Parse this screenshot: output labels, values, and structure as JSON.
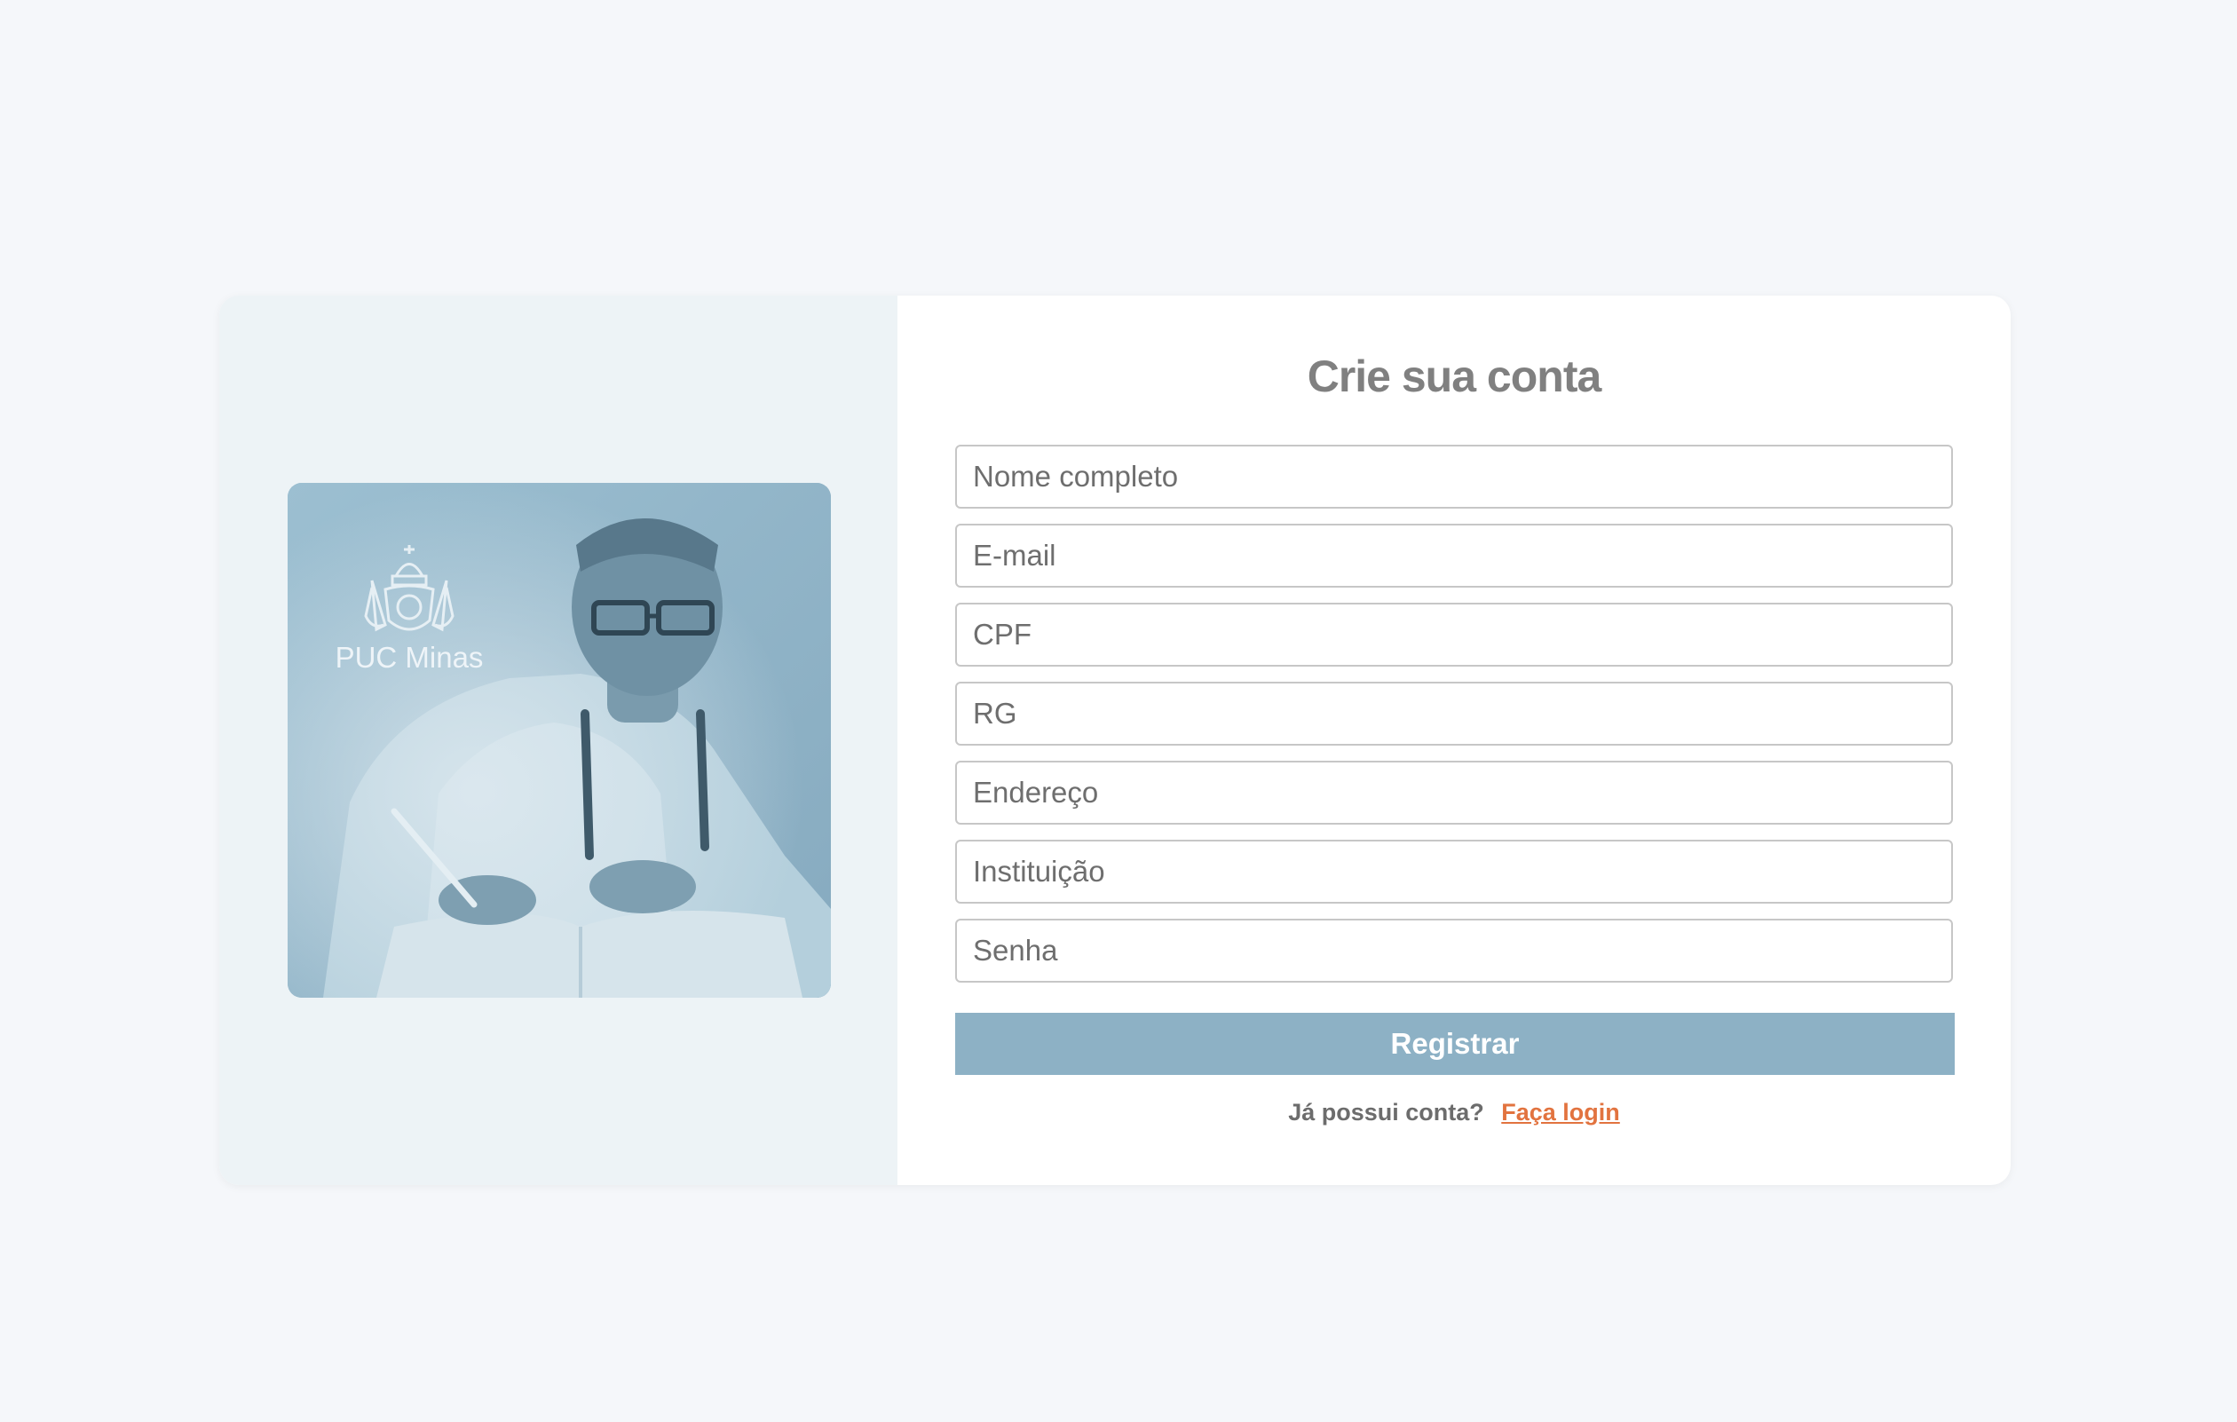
{
  "brand": {
    "logo_text": "PUC Minas"
  },
  "form": {
    "title": "Crie sua conta",
    "fields": [
      {
        "placeholder": "Nome completo"
      },
      {
        "placeholder": "E-mail"
      },
      {
        "placeholder": "CPF"
      },
      {
        "placeholder": "RG"
      },
      {
        "placeholder": "Endereço"
      },
      {
        "placeholder": "Instituição"
      },
      {
        "placeholder": "Senha"
      }
    ],
    "submit_label": "Registrar",
    "login_prompt": "Já possui conta?",
    "login_link": "Faça login"
  },
  "colors": {
    "page_background": "#f5f7fa",
    "left_panel": "#edf3f6",
    "accent_button": "#8db1c5",
    "link": "#e2733f",
    "title_text": "#808080"
  }
}
